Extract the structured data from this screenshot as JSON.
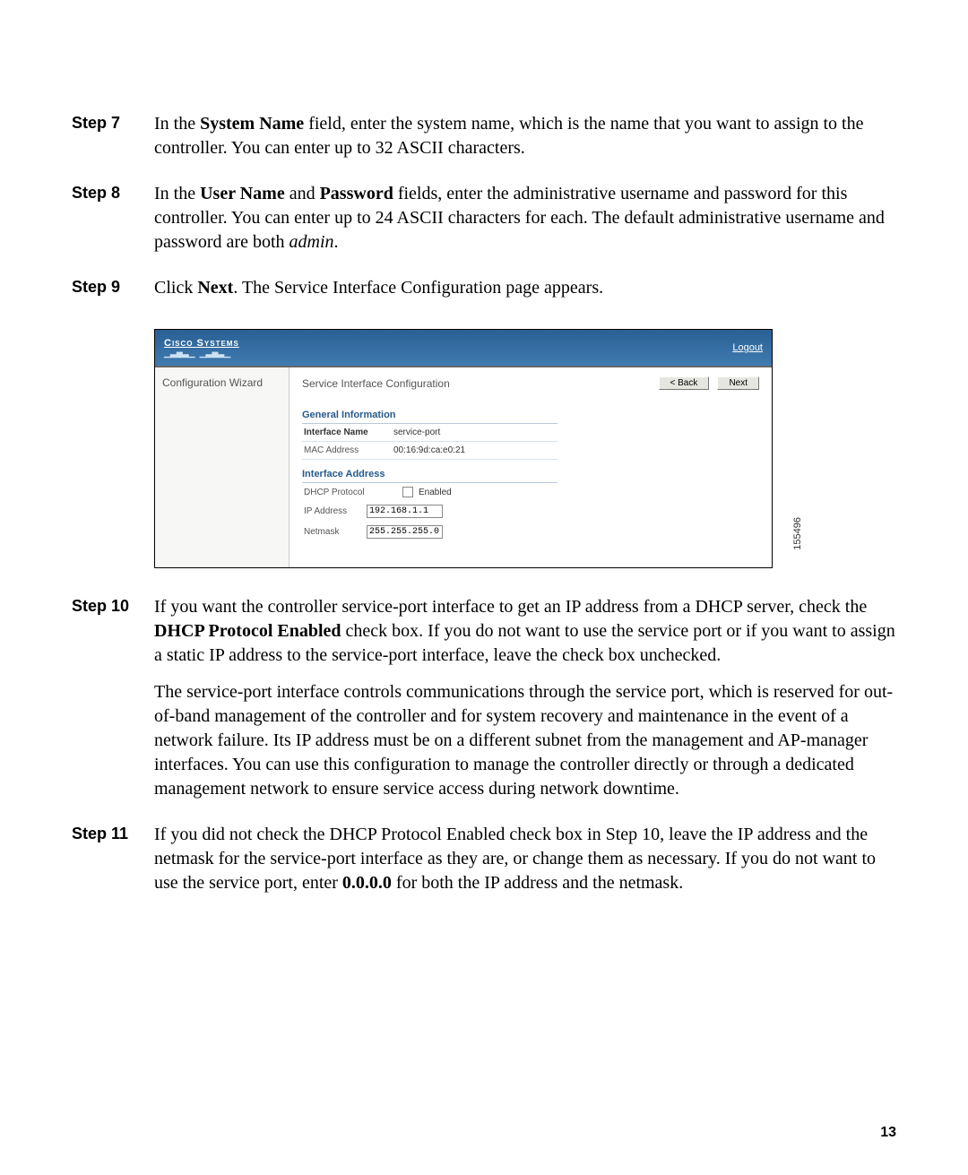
{
  "steps": {
    "s7": {
      "label": "Step 7",
      "text_pre": "In the ",
      "bold1": "System Name",
      "text_post": " field, enter the system name, which is the name that you want to assign to the controller. You can enter up to 32 ASCII characters."
    },
    "s8": {
      "label": "Step 8",
      "t1": "In the ",
      "b1": "User Name",
      "t2": " and ",
      "b2": "Password",
      "t3": " fields, enter the administrative username and password for this controller. You can enter up to 24 ASCII characters for each. The default administrative username and password are both ",
      "i1": "admin",
      "t4": "."
    },
    "s9": {
      "label": "Step 9",
      "t1": "Click ",
      "b1": "Next",
      "t2": ". The Service Interface Configuration page appears."
    },
    "s10": {
      "label": "Step 10",
      "p1a": "If you want the controller service-port interface to get an IP address from a DHCP server, check the ",
      "p1b": "DHCP Protocol Enabled",
      "p1c": " check box. If you do not want to use the service port or if you want to assign a static IP address to the service-port interface, leave the check box unchecked.",
      "p2": "The service-port interface controls communications through the service port, which is reserved for out-of-band management of the controller and for system recovery and maintenance in the event of a network failure. Its IP address must be on a different subnet from the management and AP-manager interfaces. You can use this configuration to manage the controller directly or through a dedicated management network to ensure service access during network downtime."
    },
    "s11": {
      "label": "Step 11",
      "t1": "If you did not check the DHCP Protocol Enabled check box in Step 10, leave the IP address and the netmask for the service-port interface as they are, or change them as necessary. If you do not want to use the service port, enter ",
      "b1": "0.0.0.0",
      "t2": " for both the IP address and the netmask."
    }
  },
  "figure": {
    "brand": "Cisco Systems",
    "logout": "Logout",
    "sidebar_title": "Configuration Wizard",
    "page_title": "Service Interface Configuration",
    "btn_back": "< Back",
    "btn_next": "Next",
    "section_general": "General Information",
    "row_ifname_label": "Interface Name",
    "row_ifname_value": "service-port",
    "row_mac_label": "MAC Address",
    "row_mac_value": "00:16:9d:ca:e0:21",
    "section_address": "Interface Address",
    "row_dhcp_label": "DHCP Protocol",
    "row_dhcp_cb": "Enabled",
    "row_ip_label": "IP Address",
    "row_ip_value": "192.168.1.1",
    "row_nm_label": "Netmask",
    "row_nm_value": "255.255.255.0",
    "fig_id": "155496"
  },
  "page_number": "13"
}
